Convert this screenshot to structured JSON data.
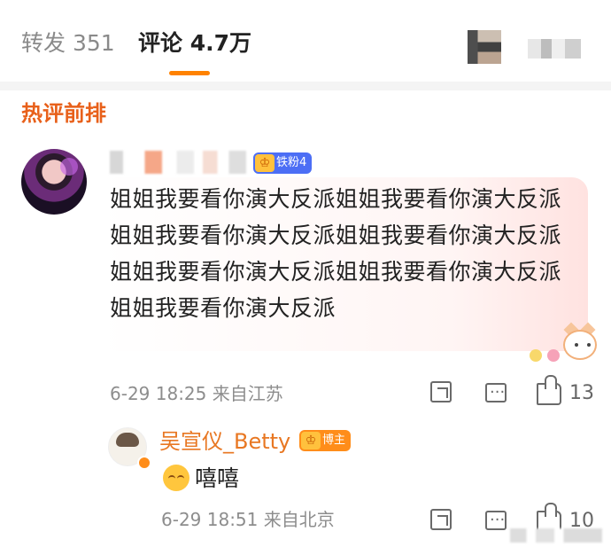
{
  "tabs": [
    {
      "label": "转发 351"
    },
    {
      "label": "评论 4.7万"
    }
  ],
  "section": {
    "title": "热评前排"
  },
  "comment": {
    "badge": "铁粉4",
    "text": "姐姐我要看你演大反派姐姐我要看你演大反派姐姐我要看你演大反派姐姐我要看你演大反派姐姐我要看你演大反派姐姐我要看你演大反派姐姐我要看你演大反派",
    "meta": "6-29 18:25  来自江苏",
    "likes": "13"
  },
  "reply": {
    "name": "吴宣仪_Betty",
    "badge": "博主",
    "text": "嘻嘻",
    "meta": "6-29 18:51  来自北京",
    "likes": "10"
  },
  "icons": {
    "share": "share-icon",
    "comment": "comment-icon",
    "like": "like-icon"
  },
  "colors": {
    "accent": "#ff8200",
    "hot_title": "#e8601a",
    "reply_name": "#e87722",
    "fan_badge": "#4c6ef5",
    "blogger_badge": "#ff8d1a"
  }
}
